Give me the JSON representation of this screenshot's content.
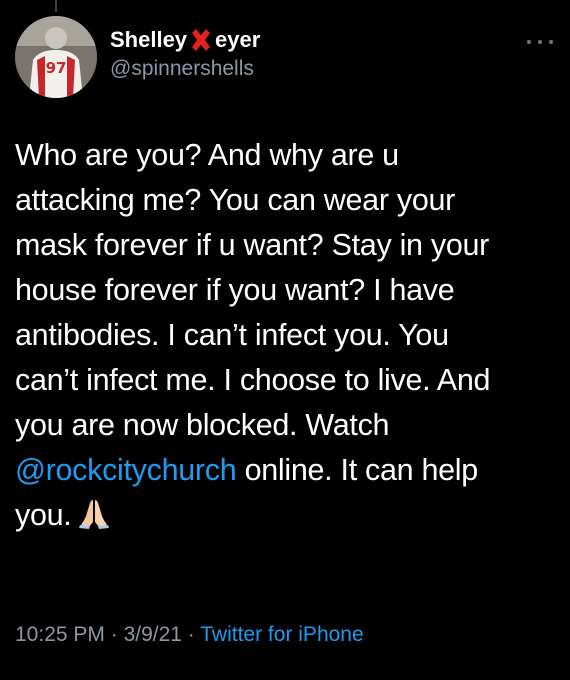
{
  "colors": {
    "background": "#000000",
    "text": "#ffffff",
    "secondary_text": "#8b98a5",
    "link": "#1d9bf0",
    "x_mark": "#e0231e"
  },
  "author": {
    "name_prefix": "Shelley",
    "name_mark_icon": "red-x-mark-icon",
    "name_suffix": "eyer",
    "handle": "@spinnershells",
    "avatar_icon": "football-player-avatar"
  },
  "header": {
    "more_icon": "more-options-icon"
  },
  "tweet": {
    "lines": [
      "Who are you? And why are u",
      "attacking me? You can wear your",
      "mask forever if u want? Stay in your",
      "house forever if you want? I have",
      "antibodies. I can’t infect you. You",
      "can’t infect me. I choose to live. And",
      "you are now blocked. Watch"
    ],
    "mention": "@rockcitychurch",
    "after_mention": " online. It can help",
    "last_line": "you.",
    "emoji_icon": "folded-hands-icon"
  },
  "meta": {
    "time": "10:25 PM",
    "separator": " · ",
    "date": "3/9/21",
    "separator2": " · ",
    "source": "Twitter for iPhone"
  }
}
